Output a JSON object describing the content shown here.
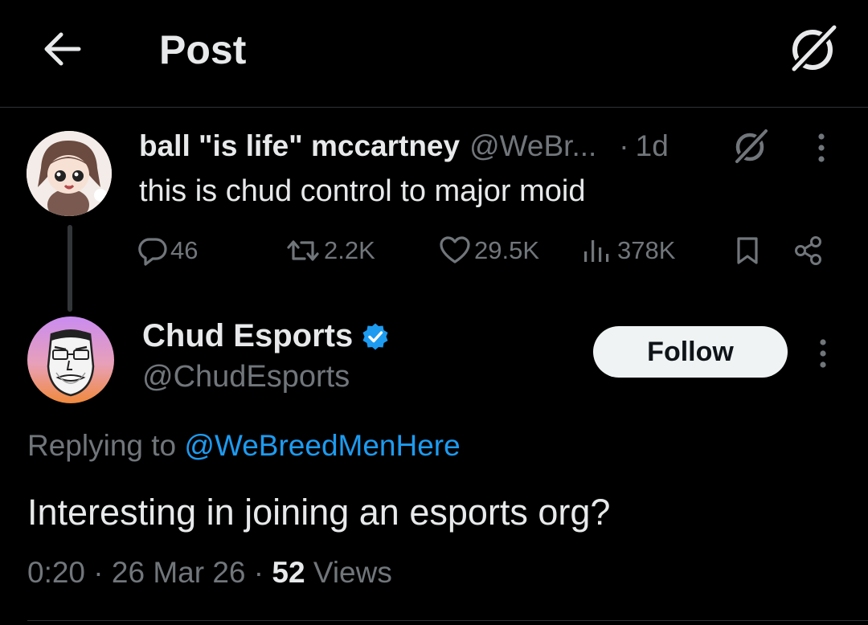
{
  "header": {
    "title": "Post",
    "back_icon": "arrow-left-icon",
    "grok_icon": "grok-icon"
  },
  "parent_tweet": {
    "name": "ball \"is life\" mccartney",
    "handle": "@WeBr...",
    "separator": "·",
    "time": "1d",
    "text": "this is chud control to major moid",
    "actions": {
      "replies": "46",
      "reposts": "2.2K",
      "likes": "29.5K",
      "views": "378K"
    },
    "icons": [
      "reply-icon",
      "repost-icon",
      "like-icon",
      "views-icon",
      "bookmark-icon",
      "share-icon",
      "grok-icon",
      "more-icon"
    ]
  },
  "main_tweet": {
    "name": "Chud Esports",
    "handle": "@ChudEsports",
    "verified": true,
    "follow_label": "Follow",
    "replying_prefix": "Replying to ",
    "replying_to": "@WeBreedMenHere",
    "text": "Interesting in joining an esports org?",
    "time": "0:20",
    "sep1": " · ",
    "date": "26 Mar 26",
    "sep2": " · ",
    "views_count": "52",
    "views_label": " Views"
  },
  "colors": {
    "background": "#000000",
    "text": "#e7e9ea",
    "muted": "#71767b",
    "accent": "#1d9bf0",
    "divider": "#2f3336"
  }
}
